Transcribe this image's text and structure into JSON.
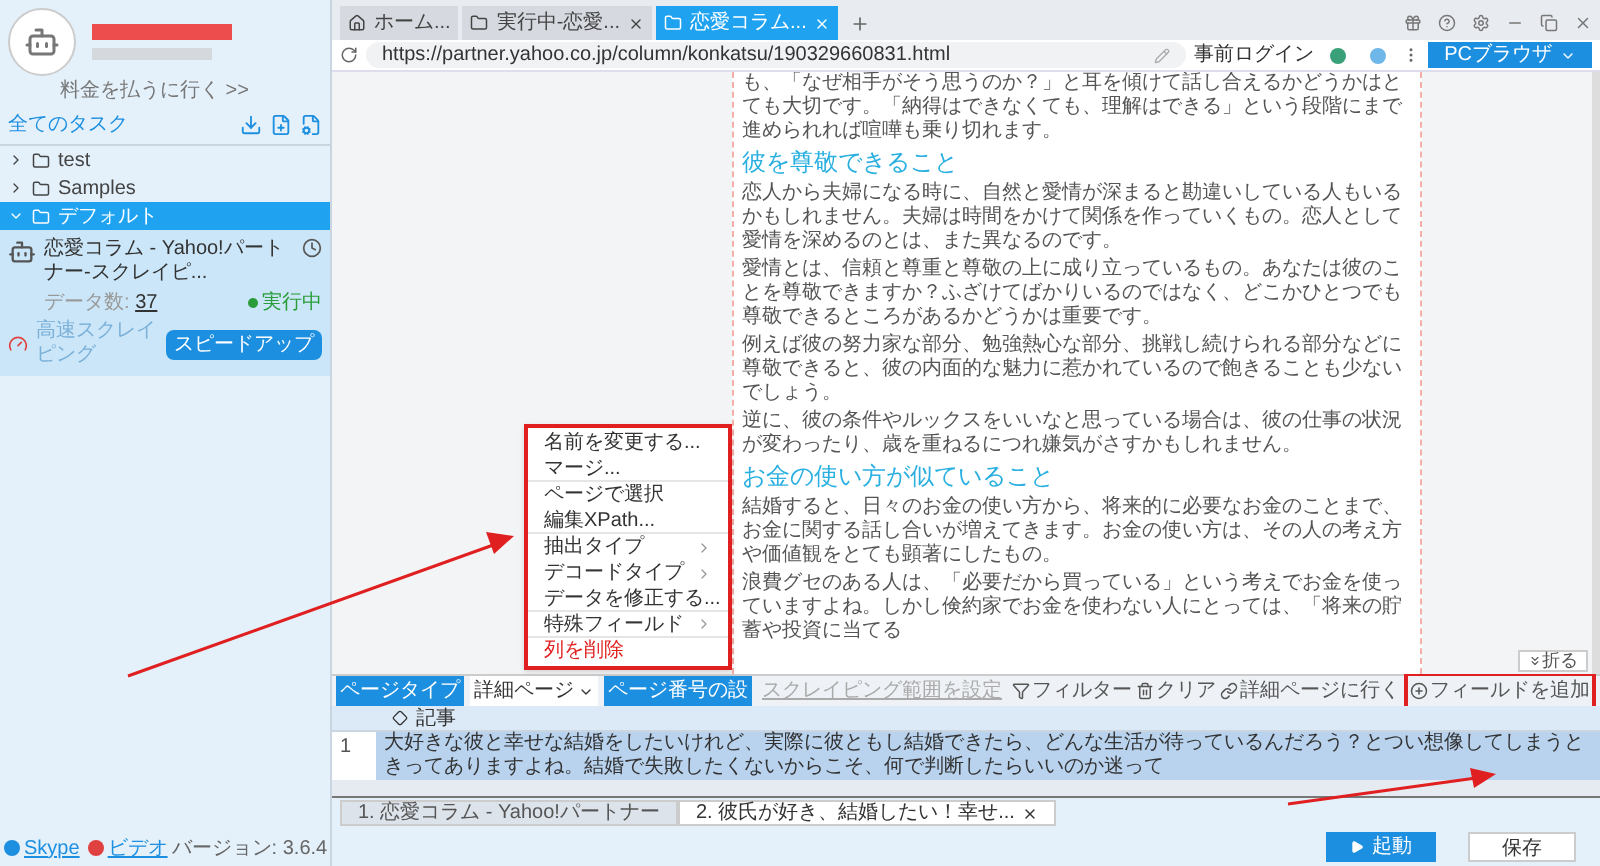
{
  "sidebar": {
    "pay_link": "料金を払うに行く >>",
    "tasks_title": "全てのタスク",
    "tree": [
      {
        "label": "test",
        "expanded": false,
        "selected": false
      },
      {
        "label": "Samples",
        "expanded": false,
        "selected": false
      },
      {
        "label": "デフォルト",
        "expanded": true,
        "selected": true
      }
    ],
    "task": {
      "name": "恋愛コラム - Yahoo!パートナー-スクレイピ...",
      "count_label": "データ数:",
      "count": "37",
      "status": "実行中",
      "mode": "高速スクレイピング",
      "speed_button": "スピードアップ"
    },
    "footer": {
      "skype": "Skype",
      "video": "ビデオ",
      "version": "バージョン: 3.6.4"
    }
  },
  "tabs": [
    {
      "label": "ホーム...",
      "selected": false,
      "closable": false
    },
    {
      "label": "実行中-恋愛...",
      "selected": false,
      "closable": true
    },
    {
      "label": "恋愛コラム...",
      "selected": true,
      "closable": true
    }
  ],
  "address_bar": {
    "url": "https://partner.yahoo.co.jp/column/konkatsu/190329660831.html",
    "login": "事前ログイン",
    "browser_button": "PCブラウザ"
  },
  "article": [
    {
      "kind": "paragraph",
      "text": "も、「なぜ相手がそう思うのか？」と耳を傾けて話し合えるかどうかはとても大切です。「納得はできなくても、理解はできる」という段階にまで進められれば喧嘩も乗り切れます。"
    },
    {
      "kind": "heading",
      "text": "彼を尊敬できること"
    },
    {
      "kind": "paragraph",
      "text": "恋人から夫婦になる時に、自然と愛情が深まると勘違いしている人もいるかもしれません。夫婦は時間をかけて関係を作っていくもの。恋人として愛情を深めるのとは、また異なるのです。"
    },
    {
      "kind": "paragraph",
      "text": "愛情とは、信頼と尊重と尊敬の上に成り立っているもの。あなたは彼のことを尊敬できますか？ふざけてばかりいるのではなく、どこかひとつでも尊敬できるところがあるかどうかは重要です。"
    },
    {
      "kind": "paragraph",
      "text": "例えば彼の努力家な部分、勉強熱心な部分、挑戦し続けられる部分などに尊敬できると、彼の内面的な魅力に惹かれているので飽きることも少ないでしょう。"
    },
    {
      "kind": "paragraph",
      "text": "逆に、彼の条件やルックスをいいなと思っている場合は、彼の仕事の状況が変わったり、歳を重ねるにつれ嫌気がさすかもしれません。"
    },
    {
      "kind": "heading",
      "text": "お金の使い方が似ていること"
    },
    {
      "kind": "paragraph",
      "text": "結婚すると、日々のお金の使い方から、将来的に必要なお金のことまで、お金に関する話し合いが増えてきます。お金の使い方は、その人の考え方や価値観をとても顕著にしたもの。"
    },
    {
      "kind": "paragraph",
      "text": "浪費グセのある人は、「必要だから買っている」という考えでお金を使っていますよね。しかし倹約家でお金を使わない人にとっては、「将来の貯蓄や投資に当てる"
    }
  ],
  "collapse_button": "折る",
  "toolbar": {
    "page_type_label": "ページタイプ",
    "page_type_value": "詳細ページ",
    "page_number_button": "ページ番号の設",
    "range_link": "スクレイピング範囲を設定",
    "actions": [
      {
        "kind": "filter",
        "label": "フィルター"
      },
      {
        "kind": "clear",
        "label": "クリア"
      },
      {
        "kind": "link",
        "label": "詳細ページに行く"
      },
      {
        "kind": "add",
        "label": "フィールドを追加"
      }
    ]
  },
  "context_menu": [
    {
      "label": "名前を変更する...",
      "submenu": false,
      "danger": false,
      "group_end": false
    },
    {
      "label": "マージ...",
      "submenu": false,
      "danger": false,
      "group_end": true
    },
    {
      "label": "ページで選択",
      "submenu": false,
      "danger": false,
      "group_end": false
    },
    {
      "label": "編集XPath...",
      "submenu": false,
      "danger": false,
      "group_end": true
    },
    {
      "label": "抽出タイプ",
      "submenu": true,
      "danger": false,
      "group_end": false
    },
    {
      "label": "デコードタイプ",
      "submenu": true,
      "danger": false,
      "group_end": false
    },
    {
      "label": "データを修正する...",
      "submenu": false,
      "danger": false,
      "group_end": true
    },
    {
      "label": "特殊フィールド",
      "submenu": true,
      "danger": false,
      "group_end": true
    },
    {
      "label": "列を削除",
      "submenu": false,
      "danger": true,
      "group_end": false
    }
  ],
  "table": {
    "columns": [
      "記事"
    ],
    "rows": [
      {
        "index": "1",
        "cells": [
          "大好きな彼と幸せな結婚をしたいけれど、実際に彼ともし結婚できたら、どんな生活が待っているんだろう？とつい想像してしまうときってありますよね。結婚で失敗したくないからこそ、何で判断したらいいのか迷って"
        ],
        "selected": true
      }
    ]
  },
  "bottom_tabs": [
    {
      "label": "1. 恋愛コラム - Yahoo!パートナー",
      "selected": false,
      "closable": false
    },
    {
      "label": "2. 彼氏が好き、結婚したい！幸せ...",
      "selected": true,
      "closable": true
    }
  ],
  "buttons": {
    "start": "起動",
    "save": "保存"
  }
}
